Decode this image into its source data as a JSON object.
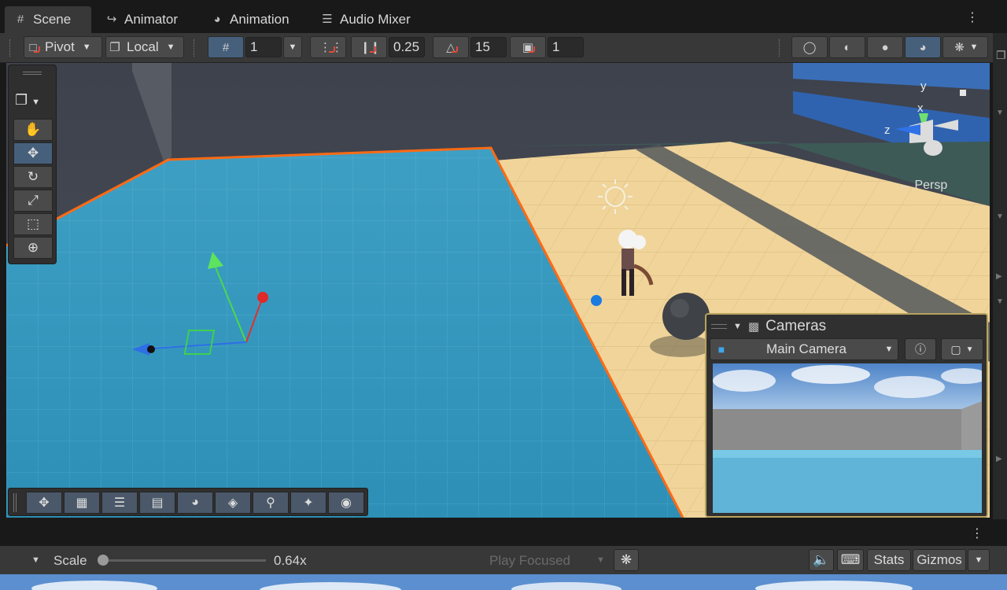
{
  "tabs": [
    {
      "label": "Scene",
      "icon": "grid-icon",
      "active": true
    },
    {
      "label": "Animator",
      "icon": "animator-icon",
      "active": false
    },
    {
      "label": "Animation",
      "icon": "animation-icon",
      "active": false
    },
    {
      "label": "Audio Mixer",
      "icon": "audio-mixer-icon",
      "active": false
    }
  ],
  "toolbar": {
    "pivot_label": "Pivot",
    "local_label": "Local",
    "grid_size": "1",
    "move_snap": "0.25",
    "rotate_snap": "15",
    "scale_snap": "1"
  },
  "gizmo": {
    "y_label": "y",
    "x_label": "x",
    "z_label": "z",
    "projection_label": "← Persp"
  },
  "tools": [
    {
      "name": "hand-tool",
      "glyph": "✋"
    },
    {
      "name": "move-tool",
      "glyph": "✥",
      "selected": true
    },
    {
      "name": "rotate-tool",
      "glyph": "↻"
    },
    {
      "name": "scale-tool",
      "glyph": "⤢"
    },
    {
      "name": "rect-tool",
      "glyph": "⬚"
    },
    {
      "name": "transform-tool",
      "glyph": "⊕"
    }
  ],
  "cameras": {
    "title": "Cameras",
    "selected_camera": "Main Camera"
  },
  "bottombar": {
    "scale_label": "Scale",
    "scale_value": "0.64x",
    "scale_fraction": 0.0,
    "play_mode": "Play Focused",
    "stats_label": "Stats",
    "gizmos_label": "Gizmos"
  },
  "colors": {
    "accent_selected": "#46607c",
    "water": "#3aa0c4",
    "sand": "#f0d49a",
    "selection_outline": "#ff6a14",
    "cameras_border": "#b8a35e"
  }
}
